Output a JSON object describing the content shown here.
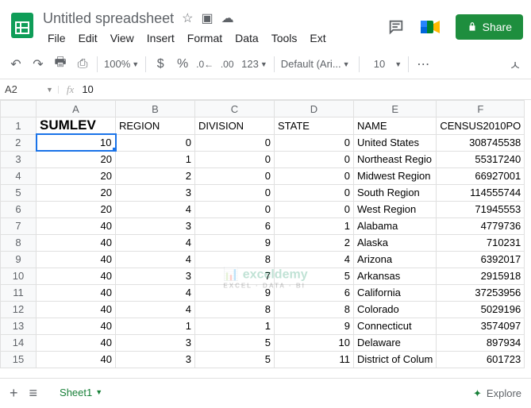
{
  "doc_title": "Untitled spreadsheet",
  "menu": [
    "File",
    "Edit",
    "View",
    "Insert",
    "Format",
    "Data",
    "Tools",
    "Ext"
  ],
  "share_label": "Share",
  "toolbar": {
    "zoom": "100%",
    "font": "Default (Ari...",
    "font_size": "10",
    "num_fmt": "123"
  },
  "name_box": "A2",
  "formula_value": "10",
  "columns": [
    "A",
    "B",
    "C",
    "D",
    "E",
    "F"
  ],
  "headers": [
    "SUMLEV",
    "REGION",
    "DIVISION",
    "STATE",
    "NAME",
    "CENSUS2010PO"
  ],
  "rows": [
    {
      "r": 2,
      "c": [
        10,
        0,
        0,
        0,
        "United States",
        308745538
      ]
    },
    {
      "r": 3,
      "c": [
        20,
        1,
        0,
        0,
        "Northeast Regio",
        55317240
      ]
    },
    {
      "r": 4,
      "c": [
        20,
        2,
        0,
        0,
        "Midwest Region",
        66927001
      ]
    },
    {
      "r": 5,
      "c": [
        20,
        3,
        0,
        0,
        "South Region",
        114555744
      ]
    },
    {
      "r": 6,
      "c": [
        20,
        4,
        0,
        0,
        "West Region",
        71945553
      ]
    },
    {
      "r": 7,
      "c": [
        40,
        3,
        6,
        1,
        "Alabama",
        4779736
      ]
    },
    {
      "r": 8,
      "c": [
        40,
        4,
        9,
        2,
        "Alaska",
        710231
      ]
    },
    {
      "r": 9,
      "c": [
        40,
        4,
        8,
        4,
        "Arizona",
        6392017
      ]
    },
    {
      "r": 10,
      "c": [
        40,
        3,
        7,
        5,
        "Arkansas",
        2915918
      ]
    },
    {
      "r": 11,
      "c": [
        40,
        4,
        9,
        6,
        "California",
        37253956
      ]
    },
    {
      "r": 12,
      "c": [
        40,
        4,
        8,
        8,
        "Colorado",
        5029196
      ]
    },
    {
      "r": 13,
      "c": [
        40,
        1,
        1,
        9,
        "Connecticut",
        3574097
      ]
    },
    {
      "r": 14,
      "c": [
        40,
        3,
        5,
        10,
        "Delaware",
        897934
      ]
    },
    {
      "r": 15,
      "c": [
        40,
        3,
        5,
        11,
        "District of Colum",
        601723
      ]
    }
  ],
  "sheet_tab": "Sheet1",
  "explore_label": "Explore",
  "selected_cell": "A2"
}
